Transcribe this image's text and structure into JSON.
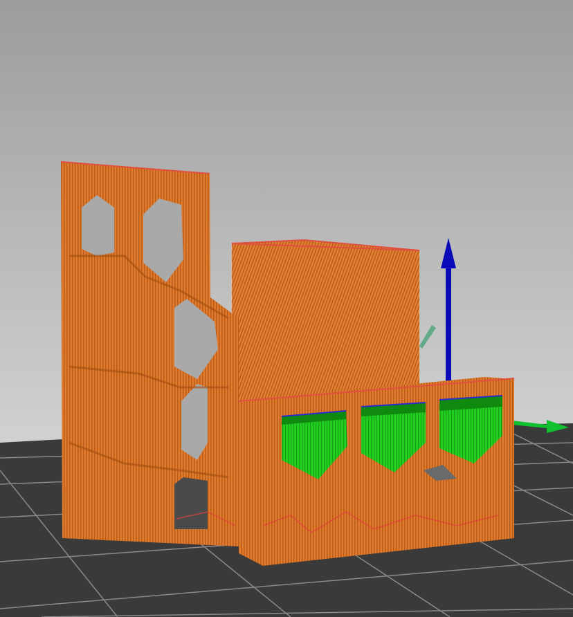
{
  "viewport": {
    "view_mode": "3d-preview",
    "colors": {
      "background_top": "#9c9c9c",
      "background_bottom": "#d2d2d2",
      "bed": "#3a3a3a",
      "bed_grid": "#9a9a9a",
      "perimeter": "#e07a2c",
      "perimeter_dark": "#b85a18",
      "overhang_perimeter": "#22d022",
      "overhang_dark": "#0f8a0f",
      "axis_z": "#0a0ab8",
      "axis_y": "#10c030",
      "axis_x_faint": "#3aa070"
    }
  }
}
